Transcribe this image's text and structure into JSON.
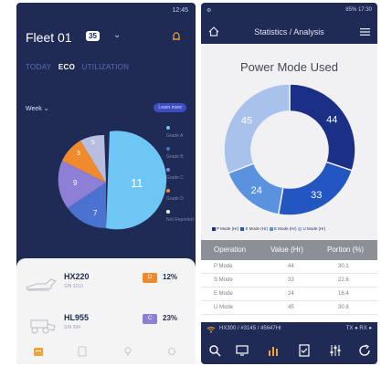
{
  "left": {
    "status_time": "12:45",
    "fleet_name": "Fleet 01",
    "fleet_count": "35",
    "tabs": [
      {
        "label": "TODAY",
        "active": false
      },
      {
        "label": "ECO",
        "active": true
      },
      {
        "label": "UTILIZATION",
        "active": false
      }
    ],
    "period": "Week",
    "learn_more": "Learn more",
    "pie_labels": [
      "11",
      "7",
      "9",
      "3",
      "5"
    ],
    "legend": [
      {
        "label": "Grade A",
        "color": "#6ec6f5"
      },
      {
        "label": "Grade B",
        "color": "#4a72d0"
      },
      {
        "label": "Grade C",
        "color": "#8e7fd6"
      },
      {
        "label": "Grade D",
        "color": "#f08a2c"
      },
      {
        "label": "Not Reported",
        "color": "#ffffff"
      }
    ],
    "machines": [
      {
        "model": "HX220",
        "sn": "S/N 3210",
        "grade": "D",
        "grade_color": "#f08a2c",
        "percent": "12%"
      },
      {
        "model": "HL955",
        "sn": "S/N 934",
        "grade": "C",
        "grade_color": "#8e7fd6",
        "percent": "23%"
      }
    ]
  },
  "right": {
    "status_text": "85% 17:30",
    "title": "Statistics / Analysis",
    "chart_data": {
      "type": "pie",
      "title": "Power Mode Used",
      "categories": [
        "P Mode (Hr)",
        "S Mode (Hr)",
        "E Mode (Hr)",
        "U Mode (Hr)"
      ],
      "values": [
        44,
        33,
        24,
        45
      ],
      "colors": [
        "#1c2f86",
        "#2356c0",
        "#5a92df",
        "#a9c2ec"
      ]
    },
    "table": {
      "headers": [
        "Operation",
        "Value (Hr)",
        "Portion (%)"
      ],
      "rows": [
        [
          "P Mode",
          "44",
          "30.1"
        ],
        [
          "S Mode",
          "33",
          "22.6"
        ],
        [
          "E Mode",
          "24",
          "16.4"
        ],
        [
          "U Mode",
          "45",
          "30.8"
        ]
      ]
    },
    "status_bar": "HX300 / #3145 / 45647Hr",
    "tx_rx": "TX ● RX ●"
  }
}
